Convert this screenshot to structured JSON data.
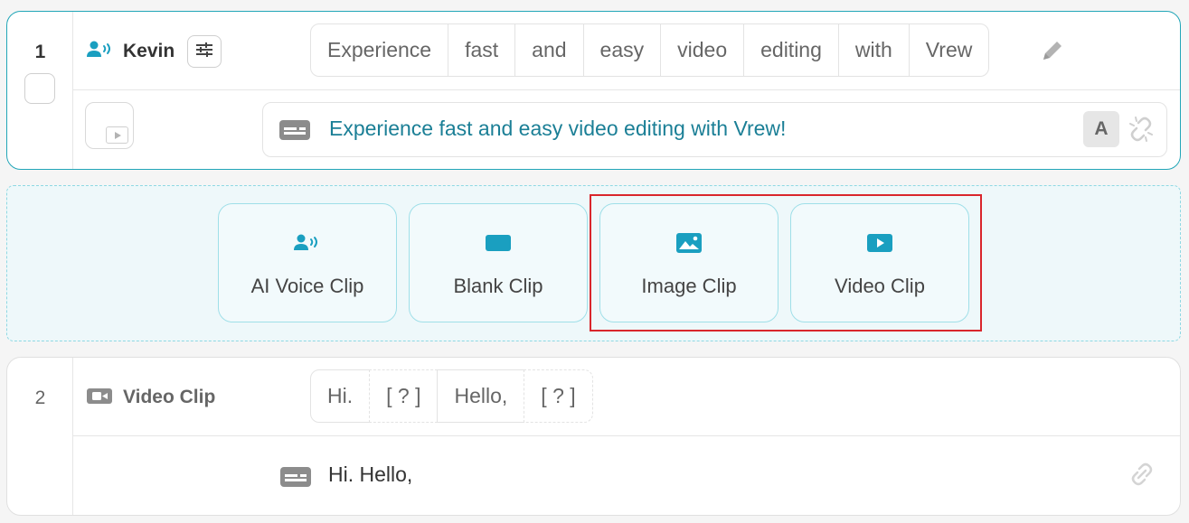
{
  "clip1": {
    "number": "1",
    "speaker": "Kevin",
    "words": [
      "Experience",
      "fast",
      "and",
      "easy",
      "video",
      "editing",
      "with",
      "Vrew"
    ],
    "subtitle": "Experience fast and easy video editing with Vrew!",
    "font_button": "A"
  },
  "insert_panel": {
    "buttons": [
      {
        "label": "AI Voice Clip",
        "icon": "ai-voice-icon"
      },
      {
        "label": "Blank Clip",
        "icon": "blank-clip-icon"
      },
      {
        "label": "Image Clip",
        "icon": "image-icon"
      },
      {
        "label": "Video Clip",
        "icon": "video-play-icon"
      }
    ]
  },
  "clip2": {
    "number": "2",
    "speaker": "Video Clip",
    "words": [
      "Hi.",
      "[ ? ]",
      "Hello,",
      "[ ? ]"
    ],
    "subtitle": "Hi. Hello,"
  },
  "colors": {
    "accent": "#1a9fc0",
    "subtitle_text": "#1b7f96",
    "highlight": "#d9262c",
    "panel_bg": "#eef8fa"
  }
}
